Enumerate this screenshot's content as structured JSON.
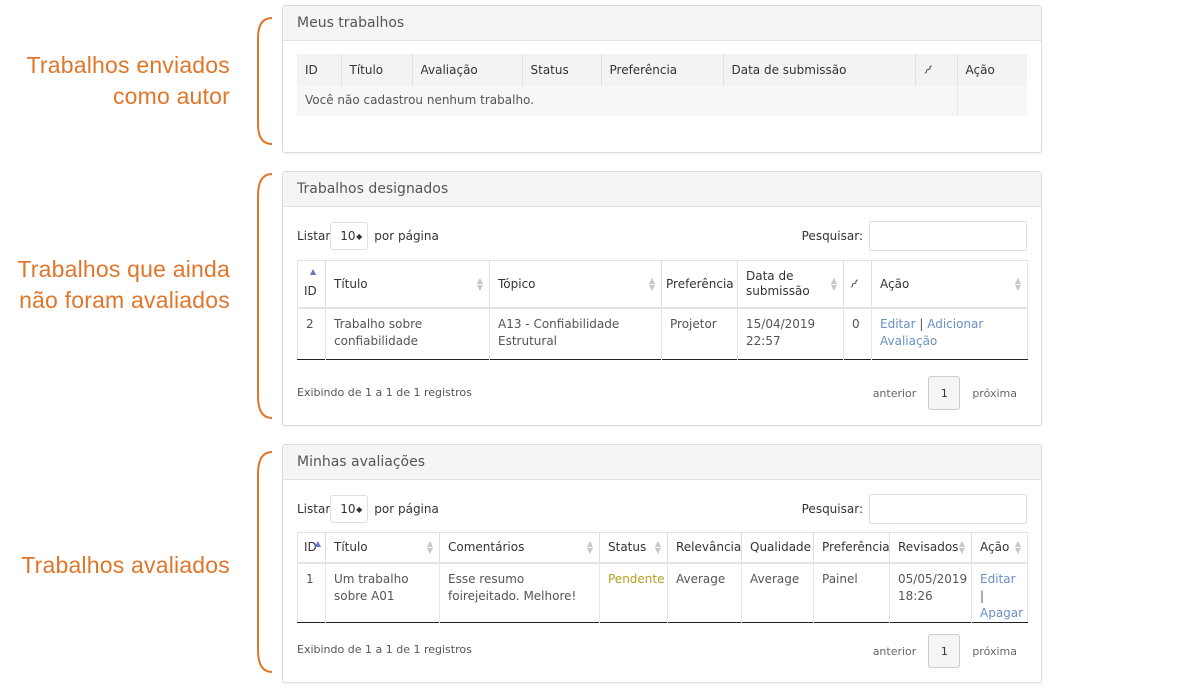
{
  "annotations": [
    {
      "lines": [
        "Trabalhos enviados",
        "como autor"
      ]
    },
    {
      "lines": [
        "Trabalhos que ainda",
        "não foram avaliados"
      ]
    },
    {
      "lines": [
        "Trabalhos avaliados"
      ]
    }
  ],
  "accent_color": "#e0762a",
  "meus_trabalhos": {
    "title": "Meus trabalhos",
    "columns": [
      "ID",
      "Título",
      "Avaliação",
      "Status",
      "Preferência",
      "Data de submissão",
      "paperclip-icon",
      "Ação"
    ],
    "empty_message": "Você não cadastrou nenhum trabalho."
  },
  "trabalhos_designados": {
    "title": "Trabalhos designados",
    "list_prefix": "Listar",
    "per_page": "10",
    "list_suffix": "por página",
    "search_label": "Pesquisar:",
    "columns": [
      "ID",
      "Título",
      "Tópico",
      "Preferência",
      "Data de submissão",
      "paperclip-icon",
      "Ação"
    ],
    "rows": [
      {
        "id": "2",
        "titulo": "Trabalho sobre confiabilidade",
        "topico": "A13 - Confiabilidade Estrutural",
        "preferencia": "Projetor",
        "data": "15/04/2019 22:57",
        "anexos": "0",
        "acao_editar": "Editar",
        "acao_sep": " | ",
        "acao_adicionar": "Adicionar Avaliação"
      }
    ],
    "info": "Exibindo de 1 a 1 de 1 registros",
    "prev": "anterior",
    "page": "1",
    "next": "próxima"
  },
  "minhas_avaliacoes": {
    "title": "Minhas avaliações",
    "list_prefix": "Listar",
    "per_page": "10",
    "list_suffix": "por página",
    "search_label": "Pesquisar:",
    "columns": [
      "ID",
      "Título",
      "Comentários",
      "Status",
      "Relevância",
      "Qualidade",
      "Preferência",
      "Revisados",
      "Ação"
    ],
    "rows": [
      {
        "id": "1",
        "titulo": "Um trabalho sobre A01",
        "comentarios": "Esse resumo foirejeitado. Melhore!",
        "status": "Pendente",
        "relevancia": "Average",
        "qualidade": "Average",
        "preferencia": "Painel",
        "revisados": "05/05/2019 18:26",
        "acao_editar": "Editar",
        "acao_sep": " |",
        "acao_apagar": "Apagar"
      }
    ],
    "info": "Exibindo de 1 a 1 de 1 registros",
    "prev": "anterior",
    "page": "1",
    "next": "próxima"
  }
}
